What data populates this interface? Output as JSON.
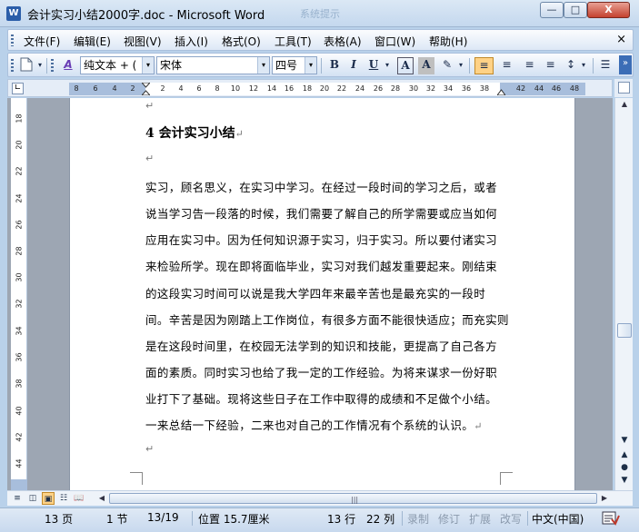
{
  "window": {
    "app_icon": "W",
    "title": "会计实习小结2000字.doc - Microsoft Word",
    "ghost_title": "系统提示",
    "minimize": "—",
    "maximize": "□",
    "close": "X"
  },
  "menu": {
    "items": [
      "文件(F)",
      "编辑(E)",
      "视图(V)",
      "插入(I)",
      "格式(O)",
      "工具(T)",
      "表格(A)",
      "窗口(W)",
      "帮助(H)"
    ],
    "doc_close": "×"
  },
  "toolbar": {
    "new_doc_icon": "new-document-icon",
    "style_icon_text": "A",
    "style_value": "纯文本 + (",
    "font_value": "宋体",
    "size_value": "四号",
    "bold": "B",
    "italic": "I",
    "underline": "U",
    "char_border": "A",
    "char_shading": "A",
    "highlight": "✎",
    "align_left": "≡",
    "center": "≡",
    "align_right": "≡",
    "justify": "≡",
    "line_spacing": "↕",
    "list": "☰",
    "dropdown": "▾",
    "more": "»"
  },
  "ruler": {
    "corner": "∟",
    "ticks": [
      "8",
      "6",
      "4",
      "2",
      "2",
      "4",
      "6",
      "8",
      "10",
      "12",
      "14",
      "16",
      "18",
      "20",
      "22",
      "24",
      "26",
      "28",
      "30",
      "32",
      "34",
      "36",
      "38",
      "42",
      "44",
      "46",
      "48"
    ]
  },
  "vruler": {
    "ticks": [
      "18",
      "20",
      "22",
      "24",
      "26",
      "28",
      "30",
      "32",
      "34",
      "36",
      "38",
      "40",
      "42",
      "44"
    ]
  },
  "document": {
    "para_mark": "↵",
    "heading": "4 会计实习小结",
    "lines": [
      "实习，顾名思义，在实习中学习。在经过一段时间的学习之后，或者",
      "说当学习告一段落的时候，我们需要了解自己的所学需要或应当如何",
      "应用在实习中。因为任何知识源于实习，归于实习。所以要付诸实习",
      "来检验所学。现在即将面临毕业，实习对我们越发重要起来。刚结束",
      "的这段实习时间可以说是我大学四年来最辛苦也是最充实的一段时",
      "间。辛苦是因为刚踏上工作岗位，有很多方面不能很快适应；而充实则",
      "是在这段时间里，在校园无法学到的知识和技能，更提高了自己各方",
      "面的素质。同时实习也给了我一定的工作经验。为将来谋求一份好职",
      "业打下了基础。现将这些日子在工作中取得的成绩和不足做个小结。",
      "一来总结一下经验，二来也对自己的工作情况有个系统的认识。"
    ]
  },
  "scroll": {
    "up": "▲",
    "down": "▼",
    "left": "◀",
    "right": "▶",
    "prev_page": "▲",
    "browse": "●",
    "next_page": "▼",
    "grip": "|||"
  },
  "views": {
    "normal": "≡",
    "web": "◫",
    "print": "▣",
    "outline": "☷",
    "reading": "📖"
  },
  "status": {
    "page": "13 页",
    "section": "1 节",
    "page_of": "13/19",
    "position": "位置 15.7厘米",
    "line": "13 行",
    "column": "22 列",
    "rec": "录制",
    "trk": "修订",
    "ext": "扩展",
    "ovr": "改写",
    "language": "中文(中国)",
    "spell_icon": "spelling-check-icon"
  }
}
